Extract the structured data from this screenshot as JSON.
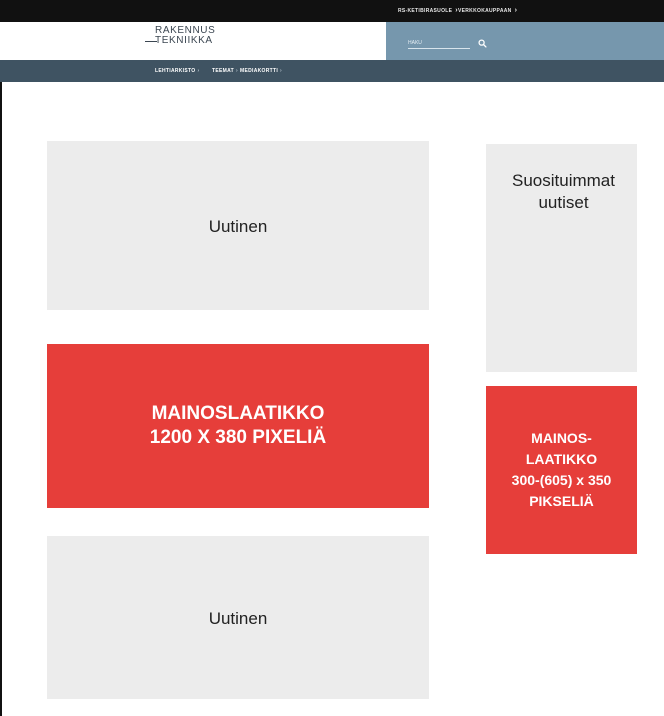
{
  "topbar": {
    "links": [
      {
        "label": "RS-KETIBIRASUOLE",
        "chevron": "›"
      },
      {
        "label": "VERKKOKAUPPAAN",
        "chevron": "›"
      }
    ]
  },
  "logo": {
    "line1": "RAKENNUS",
    "line2": "TEKNIIKKA"
  },
  "search": {
    "placeholder": "HAKU",
    "icon": "search-icon"
  },
  "nav": {
    "items": [
      {
        "label": "LEHTIARKISTO",
        "sep": "›"
      },
      {
        "label": "TEEMAT",
        "sep": "›"
      },
      {
        "label": "MEDIAKORTTI",
        "sep": "›"
      }
    ]
  },
  "main": {
    "news_top": "Uutinen",
    "ad_wide": "MAINOSLAATIKKO\n1200 X 380 PIXELIÄ",
    "news_bottom": "Uutinen"
  },
  "sidebar": {
    "popular_title": "Suosituimmat uutiset",
    "ad_small": "MAINOS-\nLAATIKKO\n300-(605) x 350\nPIKSELIÄ"
  },
  "colors": {
    "ad": "#e63e3a",
    "nav": "#3f5362",
    "search_panel": "#7697ad",
    "placeholder_box": "#ececec"
  }
}
